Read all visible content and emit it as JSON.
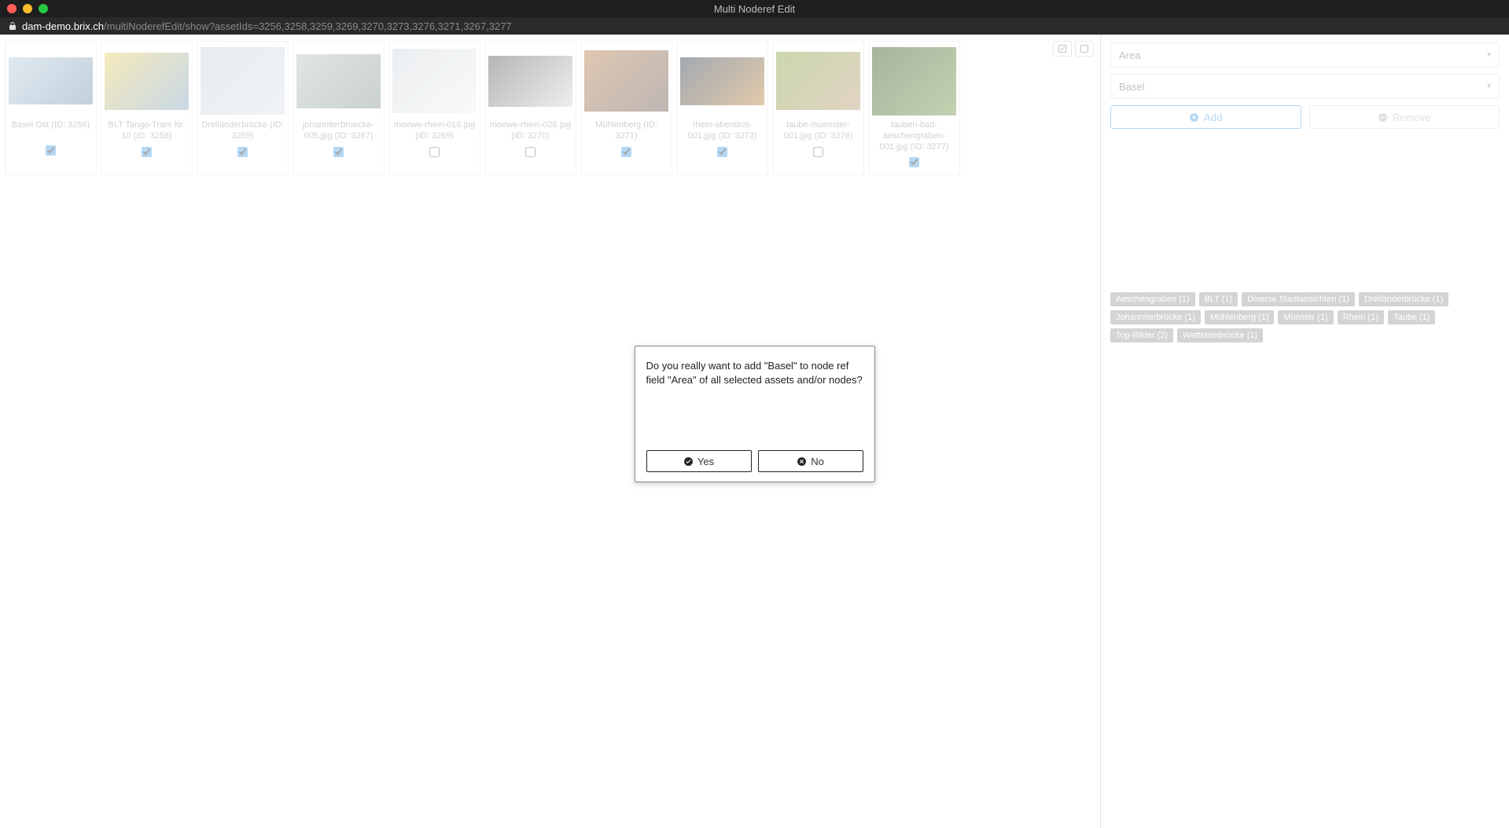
{
  "window": {
    "title": "Multi Noderef Edit",
    "url_host": "dam-demo.brix.ch",
    "url_path": "/multiNoderefEdit/show?assetIds=3256,3258,3259,3269,3270,3273,3276,3271,3267,3277"
  },
  "assets": [
    {
      "label": "Basel Ost (ID: 3256)",
      "checked": true,
      "hue1": "#bcd0e2",
      "hue2": "#7898b0"
    },
    {
      "label": "BLT Tango-Tram Nr. 10 (ID: 3258)",
      "checked": true,
      "hue1": "#e7d36b",
      "hue2": "#87a7c6"
    },
    {
      "label": "Dreiländerbrücke (ID: 3259)",
      "checked": true,
      "hue1": "#c9d6df",
      "hue2": "#dbe4ea"
    },
    {
      "label": "johanniterbruecke-005.jpg (ID: 3267)",
      "checked": true,
      "hue1": "#b9c7c2",
      "hue2": "#8c9a8e"
    },
    {
      "label": "moewe-rhein-016.jpg (ID: 3269)",
      "checked": false,
      "hue1": "#d4dadf",
      "hue2": "#eff2f4"
    },
    {
      "label": "moewe-rhein-028.jpg (ID: 3270)",
      "checked": false,
      "hue1": "#5b5f5f",
      "hue2": "#d8dcdb"
    },
    {
      "label": "Mühlenberg (ID: 3271)",
      "checked": true,
      "hue1": "#b88352",
      "hue2": "#6e5d58"
    },
    {
      "label": "rhein-abendrot-001.jpg (ID: 3273)",
      "checked": true,
      "hue1": "#33414f",
      "hue2": "#c08a4a"
    },
    {
      "label": "taube-muenster-001.jpg (ID: 3276)",
      "checked": false,
      "hue1": "#8aa64b",
      "hue2": "#bda07a"
    },
    {
      "label": "tauben-bad-aeschengraben-001.jpg (ID: 3277)",
      "checked": true,
      "hue1": "#3b5a2a",
      "hue2": "#7a9a50"
    }
  ],
  "sidebar": {
    "field_select": "Area",
    "value_select": "Basel",
    "add_label": "Add",
    "remove_label": "Remove",
    "tags": [
      "Aeschengraben (1)",
      "BLT (1)",
      "Diverse Stadtansichten (1)",
      "Dreiländerbrücke (1)",
      "Johanniterbrücke (1)",
      "Mühlenberg (1)",
      "Münster (1)",
      "Rhein (1)",
      "Taube (1)",
      "Top-Bilder (2)",
      "Wettsteinbrücke (1)"
    ]
  },
  "modal": {
    "text": "Do you really want to add \"Basel\" to node ref field \"Area\" of all selected assets and/or nodes?",
    "yes": "Yes",
    "no": "No"
  },
  "toolbar": {
    "select_all_title": "Select all",
    "select_none_title": "Select none"
  }
}
